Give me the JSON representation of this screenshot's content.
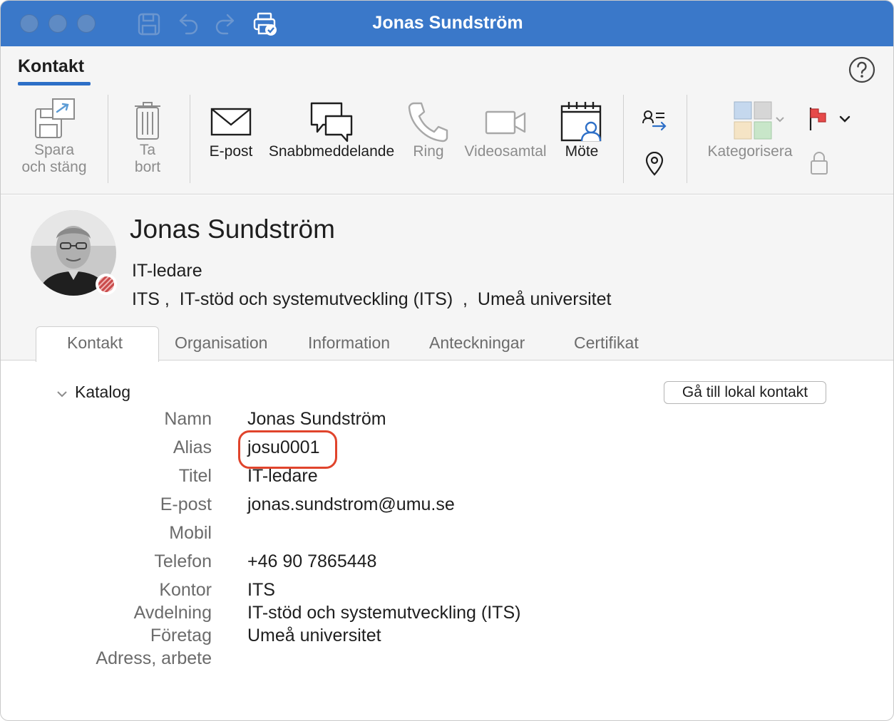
{
  "window": {
    "title": "Jonas Sundström"
  },
  "ribbon": {
    "tab_label": "Kontakt",
    "buttons": {
      "save_close": {
        "line1": "Spara",
        "line2": "och stäng",
        "icon": "save-close-icon"
      },
      "delete": {
        "line1": "Ta",
        "line2": "bort",
        "icon": "trash-icon"
      },
      "email": {
        "label": "E-post",
        "icon": "envelope-icon"
      },
      "instant_message": {
        "label": "Snabbmeddelande",
        "icon": "chat-bubbles-icon"
      },
      "call": {
        "label": "Ring",
        "icon": "phone-icon"
      },
      "video_call": {
        "label": "Videosamtal",
        "icon": "video-camera-icon"
      },
      "meeting": {
        "label": "Möte",
        "icon": "calendar-person-icon"
      },
      "categorize": {
        "label": "Kategorisera",
        "icon": "categories-icon"
      }
    }
  },
  "contact": {
    "name": "Jonas Sundström",
    "job_title": "IT-ledare",
    "org_line": {
      "office": "ITS",
      "sep1": " ,  ",
      "department": "IT-stöd och systemutveckling (ITS)",
      "sep2": "  ,  ",
      "company": "Umeå universitet"
    }
  },
  "tabs": [
    "Kontakt",
    "Organisation",
    "Information",
    "Anteckningar",
    "Certifikat"
  ],
  "section": {
    "title": "Katalog",
    "goto_button": "Gå till lokal kontakt"
  },
  "fields": {
    "name": {
      "label": "Namn",
      "value": "Jonas Sundström"
    },
    "alias": {
      "label": "Alias",
      "value": "josu0001"
    },
    "title": {
      "label": "Titel",
      "value": "IT-ledare"
    },
    "email": {
      "label": "E-post",
      "value": "jonas.sundstrom@umu.se"
    },
    "mobile": {
      "label": "Mobil",
      "value": ""
    },
    "phone": {
      "label": "Telefon",
      "value": "+46 90 7865448"
    },
    "office": {
      "label": "Kontor",
      "value": "ITS"
    },
    "department": {
      "label": "Avdelning",
      "value": "IT-stöd och systemutveckling (ITS)"
    },
    "company": {
      "label": "Företag",
      "value": "Umeå universitet"
    },
    "work_address": {
      "label": "Adress, arbete",
      "value": ""
    }
  },
  "colors": {
    "titlebar": "#3a78c9",
    "accent": "#2d6fc7",
    "highlight_ring": "#e0442c",
    "presence_busy": "#c94a4a"
  }
}
